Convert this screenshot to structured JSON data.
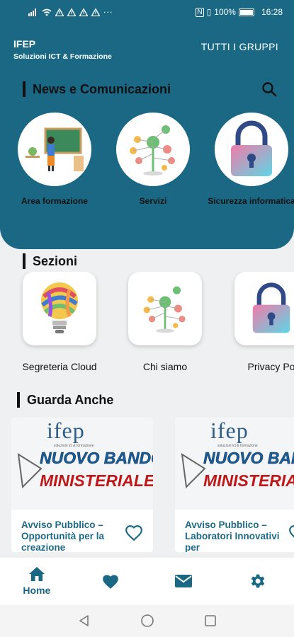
{
  "status_bar": {
    "left_icons": [
      "signal-icon",
      "wifi-icon",
      "alert-icon",
      "alert-icon",
      "alert-icon",
      "alert-icon",
      "more-icon"
    ],
    "battery_text": "100%",
    "time": "16:28"
  },
  "header": {
    "brand_title": "IFEP",
    "brand_subtitle": "Soluzioni ICT & Formazione",
    "groups_link": "TUTTI I GRUPPI",
    "news_title": "News e Comunicazioni",
    "news_items": [
      {
        "label": "Area formazione",
        "icon": "teacher-illustration"
      },
      {
        "label": "Servizi",
        "icon": "network-tree-illustration"
      },
      {
        "label": "Sicurezza informatica",
        "icon": "padlock-illustration"
      }
    ]
  },
  "sections": {
    "title": "Sezioni",
    "items": [
      {
        "label": "Segreteria Cloud",
        "icon": "lightbulb-illustration"
      },
      {
        "label": "Chi siamo",
        "icon": "network-tree-illustration"
      },
      {
        "label": "Privacy Po",
        "icon": "padlock-illustration"
      }
    ]
  },
  "guarda_anche": {
    "title": "Guarda Anche",
    "cards": [
      {
        "logo": "ifep",
        "logo_sub": "soluzioni ict & formazione",
        "banner_line1": "NUOVO BANDO",
        "banner_line2": "MINISTERIALE",
        "text": "Avviso Pubblico – Opportunità per la creazione"
      },
      {
        "logo": "ifep",
        "logo_sub": "soluzioni ict & formazione",
        "banner_line1": "NUOVO BANDO",
        "banner_line2": "MINISTERIALE",
        "text": "Avviso Pubblico – Laboratori Innovativi per"
      }
    ]
  },
  "bottom_nav": {
    "items": [
      {
        "label": "Home",
        "icon": "home-icon"
      },
      {
        "label": "",
        "icon": "heart-icon"
      },
      {
        "label": "",
        "icon": "mail-icon"
      },
      {
        "label": "",
        "icon": "gear-icon"
      }
    ]
  },
  "colors": {
    "primary": "#1a6884",
    "background": "#eef0f1",
    "card_text": "#1d6a87"
  }
}
